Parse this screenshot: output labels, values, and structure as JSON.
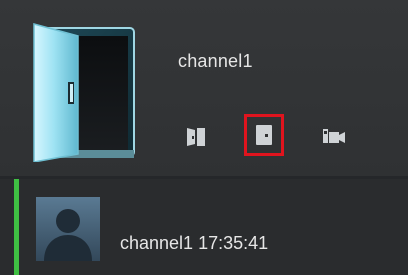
{
  "channel": {
    "name": "channel1",
    "thumbnail_icon": "door-open-icon"
  },
  "controls": [
    {
      "name": "door-open-control",
      "icon": "door-open-icon",
      "selected": false
    },
    {
      "name": "door-close-control",
      "icon": "door-closed-icon",
      "selected": true
    },
    {
      "name": "video-control",
      "icon": "video-camera-icon",
      "selected": false
    }
  ],
  "event": {
    "label": "channel1 17:35:41",
    "avatar_icon": "user-silhouette-icon",
    "accent_color": "#3fc043"
  },
  "colors": {
    "selected_border": "#e0141e",
    "background": "#2e3032"
  }
}
